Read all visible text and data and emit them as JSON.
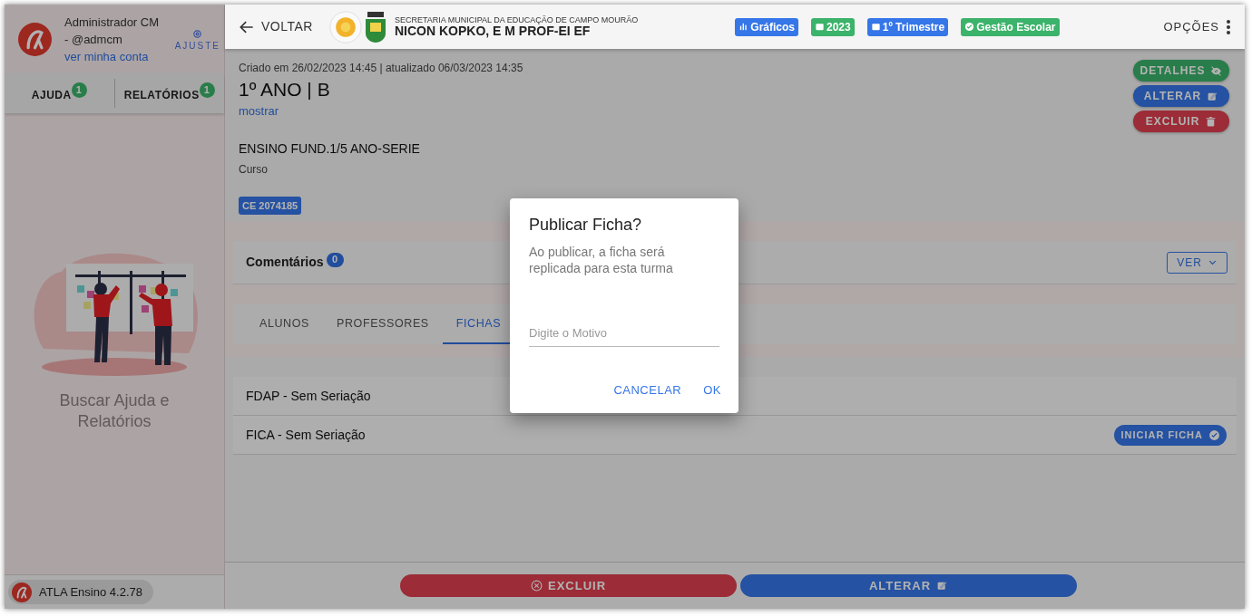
{
  "sidebar": {
    "user_name": "Administrador CM",
    "user_handle": "- @admcm",
    "account_link": "ver minha conta",
    "settings_label": "AJUSTE",
    "tabs": [
      {
        "label": "AJUDA",
        "badge": "1"
      },
      {
        "label": "RELATÓRIOS",
        "badge": "1"
      }
    ],
    "empty_message": "Buscar Ajuda e Relatórios",
    "version": "ATLA Ensino 4.2.78"
  },
  "header": {
    "back": "VOLTAR",
    "org": "SECRETARIA MUNICIPAL DA EDUCAÇÃO DE CAMPO MOURÃO",
    "school": "NICON KOPKO, E M PROF-EI EF",
    "chips": [
      {
        "label": "Gráficos",
        "kind": "chart",
        "color": "#3576e8"
      },
      {
        "label": "2023",
        "kind": "calendar",
        "color": "#3bb36a"
      },
      {
        "label": "1º Trimestre",
        "kind": "calendar",
        "color": "#3576e8"
      },
      {
        "label": "Gestão Escolar",
        "kind": "check",
        "color": "#3bb36a"
      }
    ],
    "options": "OPÇÕES"
  },
  "record": {
    "meta": "Criado em 26/02/2023 14:45 | atualizado 06/03/2023 14:35",
    "title": "1º ANO | B",
    "toggle": "mostrar",
    "course": "ENSINO FUND.1/5 ANO-SERIE",
    "course_label": "Curso",
    "code": "CE 2074185",
    "actions": [
      {
        "label": "DETALHES",
        "kind": "details"
      },
      {
        "label": "ALTERAR",
        "kind": "edit"
      },
      {
        "label": "EXCLUIR",
        "kind": "delete"
      }
    ]
  },
  "comments": {
    "title": "Comentários",
    "count": "0",
    "button": "VER"
  },
  "tabs": [
    {
      "label": "ALUNOS",
      "selected": false
    },
    {
      "label": "PROFESSORES",
      "selected": false
    },
    {
      "label": "FICHAS",
      "selected": true
    }
  ],
  "forms": [
    {
      "name": "FDAP - Sem Seriação"
    },
    {
      "name": "FICA - Sem Seriação",
      "action": "INICIAR FICHA"
    }
  ],
  "footer_actions": [
    {
      "label": "EXCLUIR",
      "kind": "delete"
    },
    {
      "label": "ALTERAR",
      "kind": "edit"
    }
  ],
  "dialog": {
    "title": "Publicar Ficha?",
    "message": "Ao publicar, a ficha será replicada para esta turma",
    "placeholder": "Digite o Motivo",
    "buttons": [
      "CANCELAR",
      "OK"
    ]
  }
}
